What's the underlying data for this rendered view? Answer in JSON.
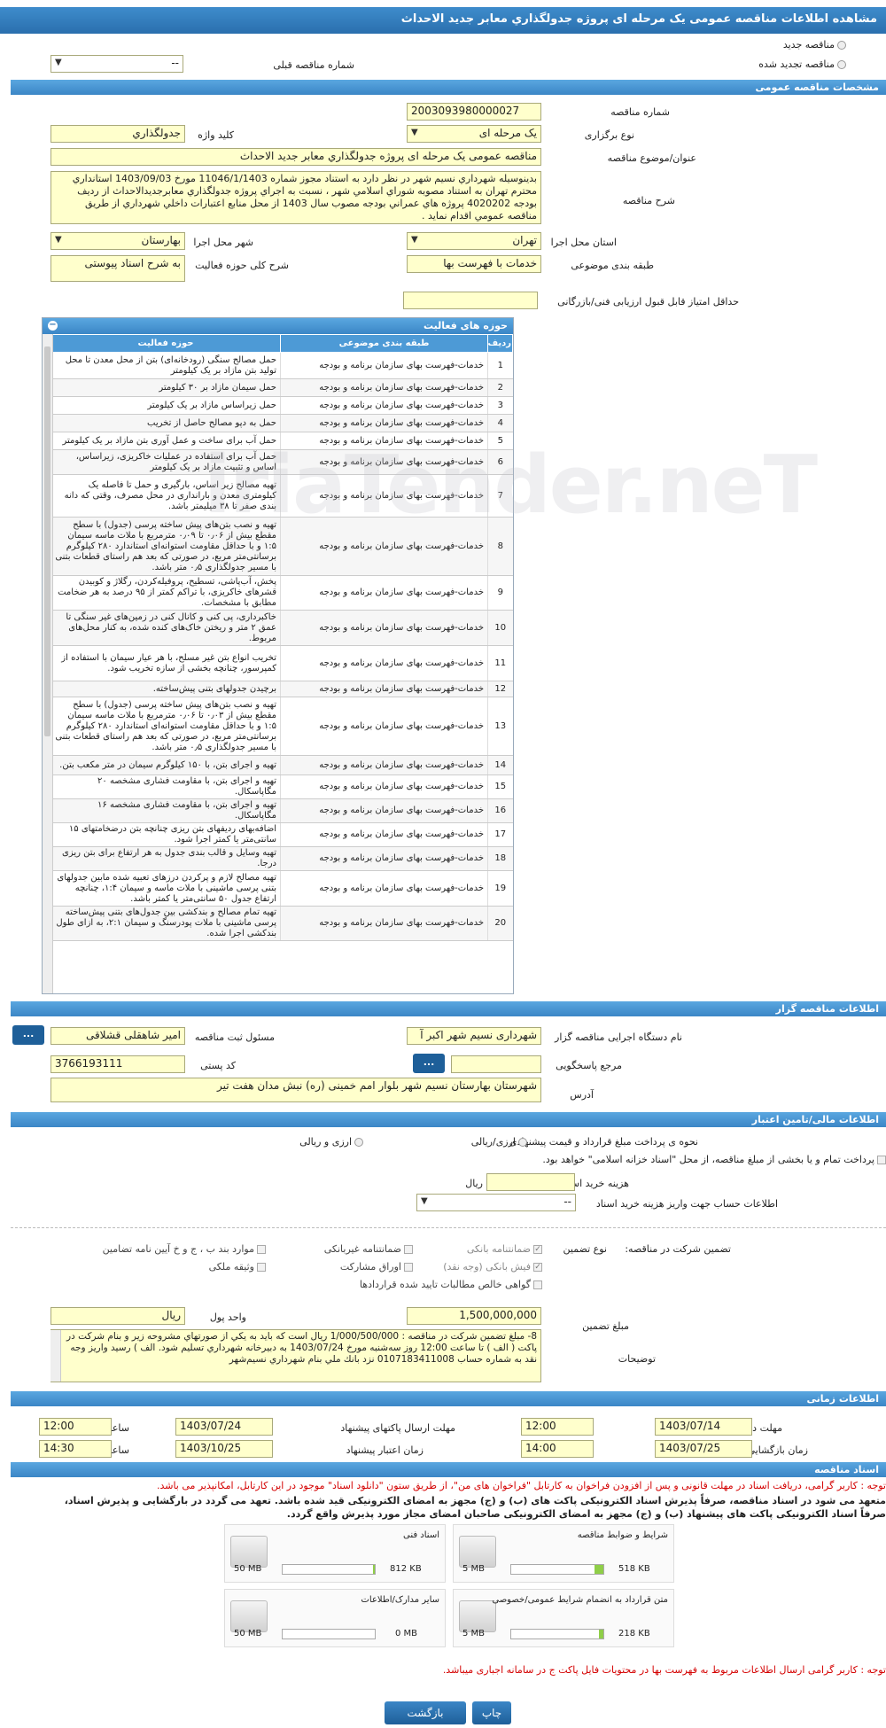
{
  "title": "مشاهده اطلاعات مناقصه عمومی یک مرحله ای پروژه جدولگذاري معابر جديد الاحداث",
  "tender_type": {
    "new": "مناقصه جدید",
    "renewed": "مناقصه تجدید شده",
    "prev_label": "شماره مناقصه قبلی",
    "prev_value": "--"
  },
  "general": {
    "header": "مشخصات مناقصه عمومی",
    "number_label": "شماره مناقصه",
    "number": "2003093980000027",
    "hold_type_label": "نوع برگزاری",
    "hold_type": "یک مرحله ای",
    "keyword_label": "کلید واژه",
    "keyword": "جدولگذاري",
    "subject_label": "عنوان/موضوع مناقصه",
    "subject": "مناقصه عمومی یک مرحله ای پروژه جدولگذاري معابر جديد الاحداث",
    "desc_label": "شرح مناقصه",
    "desc": "بدينوسيله شهرداري نسيم شهر در نظر دارد به استناد مجوز شماره 11046/1/1403 مورخ 1403/09/03 استانداري محترم تهران به استناد مصوبه شوراي اسلامي شهر ، نسبت به اجراي پروژه جدولگذاري معابرجديدالاحداث از رديف بودجه 4020202 پروژه هاي عمراني بودجه مصوب سال 1403 از محل منابع اعتبارات داخلي شهرداري از طريق مناقصه عمومي اقدام نمايد .",
    "province_label": "استان محل اجرا",
    "province": "تهران",
    "city_label": "شهر محل اجرا",
    "city": "بهارستان",
    "category_label": "طبقه بندی موضوعی",
    "category": "خدمات با فهرست بها",
    "activity_desc_label": "شرح کلی حوزه فعالیت",
    "activity_desc": "به شرح اسناد پیوستی",
    "min_score_label": "حداقل امتیاز قابل قبول ارزیابی فنی/بازرگانی",
    "min_score": ""
  },
  "activities": {
    "header": "حوزه های فعالیت",
    "cols": [
      "ردیف",
      "طبقه بندی موضوعی",
      "حوزه فعالیت"
    ],
    "rows": [
      [
        "1",
        "خدمات-فهرست بهای سازمان برنامه و بودجه",
        "حمل مصالح سنگی (رودخانه‌ای) بتن از محل معدن تا محل تولید بتن مازاد بر یک کیلومتر"
      ],
      [
        "2",
        "خدمات-فهرست بهای سازمان برنامه و بودجه",
        "حمل سیمان مازاد بر ۳۰ کیلومتر"
      ],
      [
        "3",
        "خدمات-فهرست بهای سازمان برنامه و بودجه",
        "حمل زیراساس مازاد بر یک کیلومتر"
      ],
      [
        "4",
        "خدمات-فهرست بهای سازمان برنامه و بودجه",
        "حمل به دپو مصالح حاصل از تخریب"
      ],
      [
        "5",
        "خدمات-فهرست بهای سازمان برنامه و بودجه",
        "حمل آب برای ساخت و عمل آوری بتن مازاد بر یک کیلومتر"
      ],
      [
        "6",
        "خدمات-فهرست بهای سازمان برنامه و بودجه",
        "حمل آب برای استفاده در عملیات خاکریزی، زیراساس، اساس و تثبیت مازاد بر یک کیلومتر"
      ],
      [
        "7",
        "خدمات-فهرست بهای سازمان برنامه و بودجه",
        "تهیه مصالح زیر اساس، بارگیری و حمل تا فاصله یک کیلومتری معدن و بارانداری در محل مصرف، وقتی که دانه بندی صفر تا ۳۸ میلیمتر باشد."
      ],
      [
        "8",
        "خدمات-فهرست بهای سازمان برنامه و بودجه",
        "تهیه و نصب بتن‌های پیش ساخته پرسی (جدول) با سطح مقطع بیش از ۰٫۰۶ تا ۰٫۰۹ مترمربع با ملات ماسه سیمان ۱:۵ و با حداقل مقاومت استوانه‌ای استاندارد ۲۸۰ کیلوگرم برسانتی‌متر مربع، در صورتی که بعد هم راستای قطعات بتنی با مسیر جدولگذاری ۰٫۵ متر باشد."
      ],
      [
        "9",
        "خدمات-فهرست بهای سازمان برنامه و بودجه",
        "پخش، آب‌پاشی، تسطیح، پروفیله‌کردن، رگلاژ و کوبیدن قشرهای خاکریزی، با تراکم کمتر از ۹۵ درصد به هر ضخامت مطابق با مشخصات."
      ],
      [
        "10",
        "خدمات-فهرست بهای سازمان برنامه و بودجه",
        "خاکبرداری، پی کنی و کانال کنی در زمین‌های غیر سنگی تا عمق ۲ متر و ریختن خاک‌های کنده شده، به کنار محل‌های مربوط."
      ],
      [
        "11",
        "خدمات-فهرست بهای سازمان برنامه و بودجه",
        "تخریب انواع بتن غیر مسلح، با هر عیار سیمان با استفاده از کمپرسور، چنانچه بخشی از سازه تخریب شود."
      ],
      [
        "12",
        "خدمات-فهرست بهای سازمان برنامه و بودجه",
        "برچیدن جدولهای بتنی پیش‌ساخته."
      ],
      [
        "13",
        "خدمات-فهرست بهای سازمان برنامه و بودجه",
        "تهیه و نصب بتن‌های پیش ساخته پرسی (جدول) با سطح مقطع بیش از ۰٫۰۳ تا ۰٫۰۶ مترمربع با ملات ماسه سیمان ۱:۵ و با حداقل مقاومت استوانه‌ای استاندارد ۲۸۰ کیلوگرم برسانتی‌متر مربع، در صورتی که بعد هم راستای قطعات بتنی با مسیر جدولگذاری ۰٫۵ متر باشد."
      ],
      [
        "14",
        "خدمات-فهرست بهای سازمان برنامه و بودجه",
        "تهیه و اجرای بتن، با ۱۵۰ کیلوگرم سیمان در متر مکعب بتن."
      ],
      [
        "15",
        "خدمات-فهرست بهای سازمان برنامه و بودجه",
        "تهیه و اجرای بتن، با مقاومت فشاری مشخصه ۲۰ مگاپاسکال."
      ],
      [
        "16",
        "خدمات-فهرست بهای سازمان برنامه و بودجه",
        "تهیه و اجرای بتن، با مقاومت فشاری مشخصه ۱۶ مگاپاسکال."
      ],
      [
        "17",
        "خدمات-فهرست بهای سازمان برنامه و بودجه",
        "اضافه‌بهای ردیفهای بتن ریزی چنانچه بتن درضخامتهای ۱۵ سانتی‌متر یا کمتر اجرا شود."
      ],
      [
        "18",
        "خدمات-فهرست بهای سازمان برنامه و بودجه",
        "تهیه وسایل و قالب بندی جدول به هر ارتفاع برای بتن ریزی درجا."
      ],
      [
        "19",
        "خدمات-فهرست بهای سازمان برنامه و بودجه",
        "تهیه مصالح لازم و پرکردن درزهای تعبیه شده مابین جدولهای بتنی پرسی ماشینی با ملات ماسه و سیمان ۱:۴، چنانچه ارتفاع جدول ۵۰ سانتی‌متر یا کمتر باشد."
      ],
      [
        "20",
        "خدمات-فهرست بهای سازمان برنامه و بودجه",
        "تهیه تمام مصالح و بندکشی بین جدول‌های بتنی پیش‌ساخته پرسی ماشینی با ملات پودرسنگ و سیمان ۲:۱، به ازای طول بندکشی اجرا شده."
      ]
    ]
  },
  "organizer": {
    "header": "اطلاعات مناقصه گزار",
    "org_label": "نام دستگاه اجرایی مناقصه گزار",
    "org": "شهرداری نسیم شهر اکبر آ",
    "registrar_label": "مسئول ثبت مناقصه",
    "registrar": "امیر شاهقلی قشلاقی",
    "ref_label": "مرجع پاسخگویی",
    "ref": "",
    "postal_label": "کد پستی",
    "postal": "3766193111",
    "address_label": "آدرس",
    "address": "شهرستان بهارستان نسیم شهر بلوار امم خمینی (ره) نبش مدان هفت تیر",
    "dots": "..."
  },
  "finance": {
    "header": "اطلاعات مالی/تامین اعتبار",
    "method_label": "نحوه ی پرداخت مبلغ قرارداد و قیمت پیشنهادی",
    "opt_rial": "ارزی/ریالی",
    "opt_fx": "ارزی و ریالی",
    "treasury_text": "پرداخت تمام و یا بخشی از مبلغ مناقصه، از محل \"اسناد خزانه اسلامی\" خواهد بود.",
    "doc_fee_label": "هزینه خرید اسناد",
    "doc_fee": "",
    "doc_fee_unit": "ریال",
    "account_label": "اطلاعات حساب جهت واریز هزینه خرید اسناد",
    "account": "--"
  },
  "guarantee": {
    "title_label": "تضمین شرکت در مناقصه:",
    "type_label": "نوع تضمین",
    "options": [
      "ضمانتنامه بانکی",
      "ضمانتنامه غیربانکی",
      "موارد بند ب ، ج و خ آیین نامه تضامین",
      "فیش بانکی (وجه نقد)",
      "اوراق مشارکت",
      "وثیقه ملکی",
      "گواهی خالص مطالبات تایید شده قراردادها"
    ],
    "amount_label": "مبلغ تضمین",
    "amount": "1,500,000,000",
    "currency_label": "واحد پول",
    "currency": "ریال",
    "explain_label": "توضیحات",
    "explain": "8-    مبلغ تضمين شركت در مناقصه : 1/000/500/000 ریال  است كه بايد به يكي از صورتهاي مشروحه زير و بنام شركت در پاكت ( الف ) تا ساعت 12:00 روز سه‌شنبه مورخ 1403/07/24  به دبيرخانه شهرداري تسليم شود. الف ) رسيد واريز وجه نقد به شماره حساب  0107183411008  نزد بانك ملي بنام شهرداري نسيم‌شهر"
  },
  "timing": {
    "header": "اطلاعات زمانی",
    "receive_label": "مهلت دریافت اسناد",
    "receive_date": "1403/07/14",
    "receive_time": "12:00",
    "send_label": "مهلت ارسال پاکتهای پیشنهاد",
    "send_date": "1403/07/24",
    "send_time": "12:00",
    "open_label": "زمان بازگشایی پاکت ها",
    "open_date": "1403/07/25",
    "open_time": "14:00",
    "valid_label": "زمان اعتبار پیشنهاد",
    "valid_date": "1403/10/25",
    "valid_time": "14:30",
    "time_label": "ساعت"
  },
  "docs": {
    "header": "اسناد مناقصه",
    "note1": "توجه : کاربر گرامی، دریافت اسناد در مهلت قانونی و پس از افزودن فراخوان به کارتابل \"فراخوان های من\"، از طریق ستون \"دانلود اسناد\" موجود در این کارتابل، امکانپذیر می باشد.",
    "note2": "متعهد می شود در اسناد مناقصه، صرفاً پذیرش اسناد الکترونیکی پاکت های (ب) و (ج) مجهز به امضای الکترونیکی قید شده باشد. تعهد می گردد در بارگشایی و پذیرش اسناد،",
    "note3": "صرفاً اسناد الکترونیکی پاکت های پیشنهاد (ب) و (ج) مجهز به امضای الکترونیکی صاحبان امضای مجاز مورد پذیرش واقع گردد.",
    "files": [
      {
        "name": "شرایط و ضوابط مناقصه",
        "size": "518 KB",
        "max": "5 MB",
        "fill": 0.1
      },
      {
        "name": "اسناد فنی",
        "size": "812 KB",
        "max": "50 MB",
        "fill": 0.02
      },
      {
        "name": "متن قرارداد به انضمام شرایط عمومی/خصوصی",
        "size": "218 KB",
        "max": "5 MB",
        "fill": 0.05
      },
      {
        "name": "سایر مدارک/اطلاعات",
        "size": "0 MB",
        "max": "50 MB",
        "fill": 0.0
      }
    ],
    "note4": "توجه : کاربر گرامی ارسال اطلاعات مربوط به فهرست بها در محتویات فایل پاکت ج در سامانه اجباری میباشد."
  },
  "buttons": {
    "back": "بازگشت",
    "print": "چاپ"
  },
  "colors": {
    "header_blue": "#2a6fae",
    "field_yellow": "#ffffcc",
    "note_red": "#d40000"
  }
}
